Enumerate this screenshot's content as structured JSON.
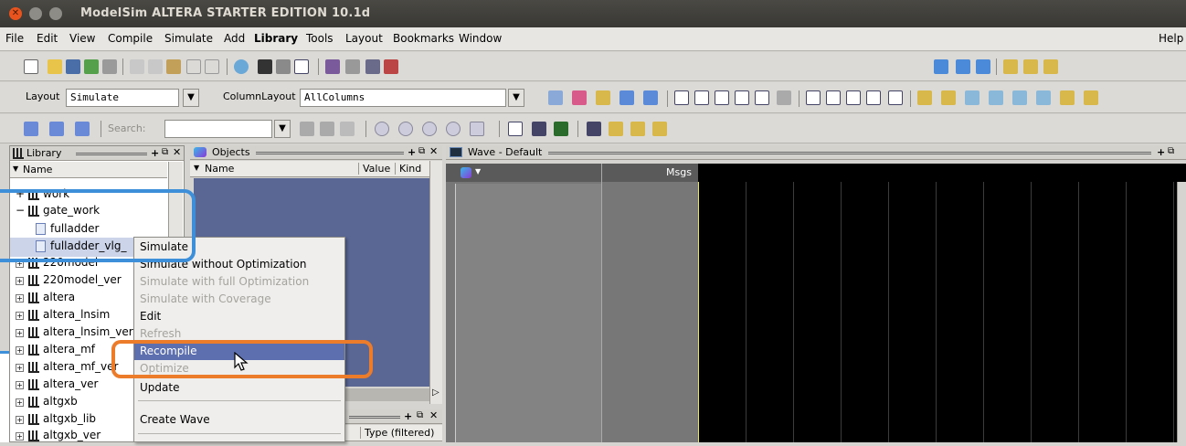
{
  "window": {
    "title": "ModelSim ALTERA STARTER EDITION 10.1d"
  },
  "menu": {
    "items": [
      "File",
      "Edit",
      "View",
      "Compile",
      "Simulate",
      "Add",
      "Library",
      "Tools",
      "Layout",
      "Bookmarks",
      "Window"
    ],
    "help": "Help"
  },
  "toolbar": {
    "layout_label": "Layout",
    "layout_value": "Simulate",
    "column_layout_label": "ColumnLayout",
    "column_layout_value": "AllColumns",
    "search_label": "Search:",
    "search_value": ""
  },
  "library_panel": {
    "title": "Library",
    "column_name": "Name",
    "items": [
      {
        "name": "work",
        "expander": "+"
      },
      {
        "name": "gate_work",
        "expander": "−"
      },
      {
        "name": "fulladder",
        "child": true
      },
      {
        "name": "fulladder_vlg_",
        "child": true
      },
      {
        "name": "220model",
        "expander": "+"
      },
      {
        "name": "220model_ver",
        "expander": "+"
      },
      {
        "name": "altera",
        "expander": "+"
      },
      {
        "name": "altera_lnsim",
        "expander": "+"
      },
      {
        "name": "altera_lnsim_ver",
        "expander": "+"
      },
      {
        "name": "altera_mf",
        "expander": "+"
      },
      {
        "name": "altera_mf_ver",
        "expander": "+"
      },
      {
        "name": "altera_ver",
        "expander": "+"
      },
      {
        "name": "altgxb",
        "expander": "+"
      },
      {
        "name": "altgxb_lib",
        "expander": "+"
      },
      {
        "name": "altgxb_ver",
        "expander": "+"
      }
    ]
  },
  "objects_panel": {
    "title": "Objects",
    "col_name": "Name",
    "col_value": "Value",
    "col_kind": "Kind",
    "col_type": "Type (filtered)"
  },
  "wave_panel": {
    "title": "Wave - Default",
    "msgs": "Msgs"
  },
  "context_menu": {
    "items": [
      {
        "label": "Simulate",
        "state": "normal"
      },
      {
        "label": "Simulate without Optimization",
        "state": "normal"
      },
      {
        "label": "Simulate with full Optimization",
        "state": "disabled"
      },
      {
        "label": "Simulate with Coverage",
        "state": "disabled"
      },
      {
        "label": "Edit",
        "state": "normal"
      },
      {
        "label": "Refresh",
        "state": "disabled"
      },
      {
        "label": "Recompile",
        "state": "highlighted"
      },
      {
        "label": "Optimize",
        "state": "disabled"
      },
      {
        "label": "Update",
        "state": "normal"
      },
      {
        "label": "Create Wave",
        "state": "normal"
      }
    ]
  },
  "colors": {
    "objects_bg": "#5a6794",
    "highlight": "#5e6faf",
    "annotation_blue": "#3d8fd9",
    "annotation_orange": "#ec7b2a"
  }
}
